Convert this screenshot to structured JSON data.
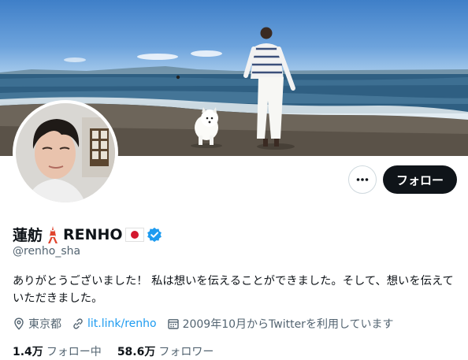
{
  "profile": {
    "name": "蓮舫",
    "name_suffix": "RENHO",
    "handle": "@renho_sha",
    "bio": "ありがとうございました！ 私は想いを伝えることができました。そして、想いを伝えていただきました。",
    "location": "東京都",
    "website": "lit.link/renho",
    "joined": "2009年10月からTwitterを利用しています",
    "following_count": "1.4万",
    "following_label": "フォロー中",
    "followers_count": "58.6万",
    "followers_label": "フォロワー",
    "verified": true
  },
  "actions": {
    "follow_label": "フォロー",
    "more_icon": "more-horizontal-icon"
  },
  "colors": {
    "accent": "#1d9bf0",
    "button_bg": "#0f1419",
    "secondary_text": "#536471"
  }
}
